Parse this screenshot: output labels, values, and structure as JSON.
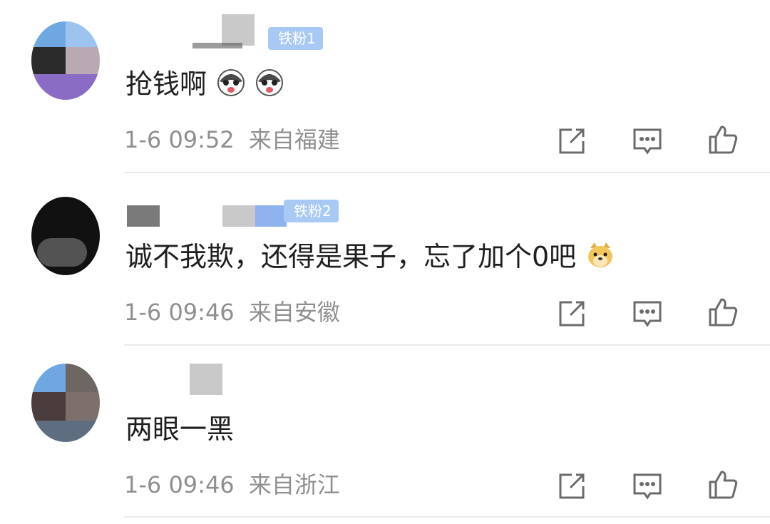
{
  "comments": [
    {
      "badge": "铁粉1",
      "text": "抢钱啊",
      "emojis": [
        "husky-emoji",
        "husky-emoji"
      ],
      "time": "1-6 09:52",
      "location": "来自福建"
    },
    {
      "badge": "铁粉2",
      "text": "诚不我欺，还得是果子，忘了加个0吧",
      "emojis": [
        "doge-emoji"
      ],
      "time": "1-6 09:46",
      "location": "来自安徽"
    },
    {
      "text": "两眼一黑",
      "time": "1-6 09:46",
      "location": "来自浙江"
    }
  ],
  "actions": [
    "share-icon",
    "reply-icon",
    "like-icon"
  ],
  "colors": {
    "badge_bg": "#a9c9f5",
    "meta_text": "#8f8f8f",
    "body_text": "#1f1f1f",
    "icon": "#6b6b6b"
  }
}
